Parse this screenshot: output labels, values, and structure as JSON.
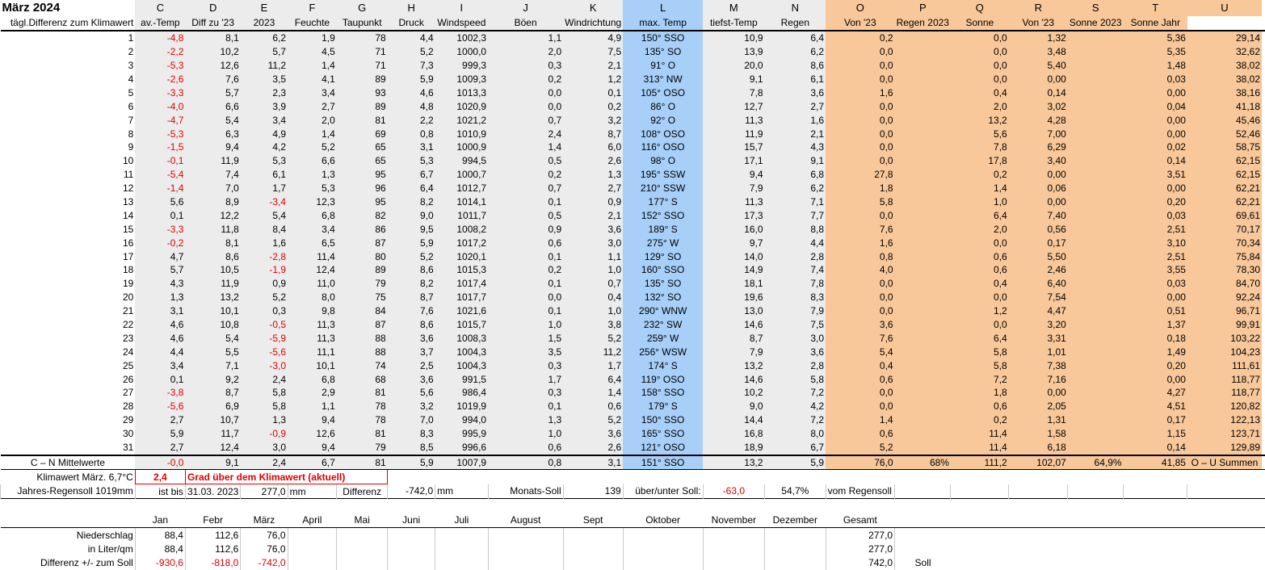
{
  "title": "März 2024",
  "col_letters": [
    "C",
    "D",
    "E",
    "F",
    "G",
    "H",
    "I",
    "J",
    "K",
    "L",
    "M",
    "N",
    "O",
    "P",
    "Q",
    "R",
    "S",
    "T",
    "U"
  ],
  "subheader": {
    "first": "tägl.Differenz zum Klimawert",
    "cols": [
      "av.-Temp",
      "Diff zu '23",
      "2023",
      "Feuchte",
      "Taupunkt",
      "Druck",
      "Windspeed",
      "Böen",
      "Windrichtung",
      "max. Temp",
      "tiefst-Temp",
      "Regen",
      "Von '23",
      "Regen 2023",
      "Sonne",
      "Von '23",
      "Sonne 2023",
      "Sonne Jahr"
    ]
  },
  "rows": [
    [
      "1",
      "-4,8",
      "8,1",
      "6,2",
      "1,9",
      "78",
      "4,4",
      "1002,3",
      "1,1",
      "4,9",
      "150° SSO",
      "10,9",
      "6,4",
      "0,2",
      "",
      "0,0",
      "1,32",
      "",
      "5,36",
      "29,14"
    ],
    [
      "2",
      "-2,2",
      "10,2",
      "5,7",
      "4,5",
      "71",
      "5,2",
      "1000,0",
      "2,0",
      "7,5",
      "135° SO",
      "13,9",
      "6,2",
      "0,0",
      "",
      "0,0",
      "3,48",
      "",
      "5,35",
      "32,62"
    ],
    [
      "3",
      "-5,3",
      "12,6",
      "11,2",
      "1,4",
      "71",
      "7,3",
      "999,3",
      "0,3",
      "2,1",
      "91° O",
      "20,0",
      "8,6",
      "0,0",
      "",
      "0,0",
      "5,40",
      "",
      "1,48",
      "38,02"
    ],
    [
      "4",
      "-2,6",
      "7,6",
      "3,5",
      "4,1",
      "89",
      "5,9",
      "1009,3",
      "0,2",
      "1,2",
      "313° NW",
      "9,1",
      "6,1",
      "0,0",
      "",
      "0,0",
      "0,00",
      "",
      "0,03",
      "38,02"
    ],
    [
      "5",
      "-3,3",
      "5,7",
      "2,3",
      "3,4",
      "93",
      "4,6",
      "1013,3",
      "0,0",
      "0,1",
      "105° OSO",
      "7,8",
      "3,6",
      "1,6",
      "",
      "0,4",
      "0,14",
      "",
      "0,00",
      "38,16"
    ],
    [
      "6",
      "-4,0",
      "6,6",
      "3,9",
      "2,7",
      "89",
      "4,8",
      "1020,9",
      "0,0",
      "0,2",
      "86° O",
      "12,7",
      "2,7",
      "0,0",
      "",
      "2,0",
      "3,02",
      "",
      "0,04",
      "41,18"
    ],
    [
      "7",
      "-4,7",
      "5,4",
      "3,4",
      "2,0",
      "81",
      "2,2",
      "1021,2",
      "0,7",
      "3,2",
      "92° O",
      "11,3",
      "1,6",
      "0,0",
      "",
      "13,2",
      "4,28",
      "",
      "0,00",
      "45,46"
    ],
    [
      "8",
      "-5,3",
      "6,3",
      "4,9",
      "1,4",
      "69",
      "0,8",
      "1010,9",
      "2,4",
      "8,7",
      "108° OSO",
      "11,9",
      "2,1",
      "0,0",
      "",
      "5,6",
      "7,00",
      "",
      "0,00",
      "52,46"
    ],
    [
      "9",
      "-1,5",
      "9,4",
      "4,2",
      "5,2",
      "65",
      "3,1",
      "1000,9",
      "1,4",
      "6,0",
      "116° OSO",
      "15,7",
      "4,3",
      "0,0",
      "",
      "7,8",
      "6,29",
      "",
      "0,02",
      "58,75"
    ],
    [
      "10",
      "-0,1",
      "11,9",
      "5,3",
      "6,6",
      "65",
      "5,3",
      "994,5",
      "0,5",
      "2,6",
      "98° O",
      "17,1",
      "9,1",
      "0,0",
      "",
      "17,8",
      "3,40",
      "",
      "0,14",
      "62,15"
    ],
    [
      "11",
      "-5,4",
      "7,4",
      "6,1",
      "1,3",
      "95",
      "6,7",
      "1000,7",
      "0,2",
      "1,3",
      "195° SSW",
      "9,4",
      "6,8",
      "27,8",
      "",
      "0,2",
      "0,00",
      "",
      "3,51",
      "62,15"
    ],
    [
      "12",
      "-1,4",
      "7,0",
      "1,7",
      "5,3",
      "96",
      "6,4",
      "1012,7",
      "0,7",
      "2,7",
      "210° SSW",
      "7,9",
      "6,2",
      "1,8",
      "",
      "1,4",
      "0,06",
      "",
      "0,00",
      "62,21"
    ],
    [
      "13",
      "5,6",
      "8,9",
      "-3,4",
      "12,3",
      "95",
      "8,2",
      "1014,1",
      "0,1",
      "0,9",
      "177° S",
      "11,3",
      "7,1",
      "5,8",
      "",
      "1,0",
      "0,00",
      "",
      "0,20",
      "62,21"
    ],
    [
      "14",
      "0,1",
      "12,2",
      "5,4",
      "6,8",
      "82",
      "9,0",
      "1011,7",
      "0,5",
      "2,1",
      "152° SSO",
      "17,3",
      "7,7",
      "0,0",
      "",
      "6,4",
      "7,40",
      "",
      "0,03",
      "69,61"
    ],
    [
      "15",
      "-3,3",
      "11,8",
      "8,4",
      "3,4",
      "86",
      "9,5",
      "1008,2",
      "0,9",
      "3,6",
      "189° S",
      "16,0",
      "8,8",
      "7,6",
      "",
      "2,0",
      "0,56",
      "",
      "2,51",
      "70,17"
    ],
    [
      "16",
      "-0,2",
      "8,1",
      "1,6",
      "6,5",
      "87",
      "5,9",
      "1017,2",
      "0,6",
      "3,0",
      "275° W",
      "9,7",
      "4,4",
      "1,6",
      "",
      "0,0",
      "0,17",
      "",
      "3,10",
      "70,34"
    ],
    [
      "17",
      "4,7",
      "8,6",
      "-2,8",
      "11,4",
      "80",
      "5,2",
      "1020,1",
      "0,1",
      "1,1",
      "129° SO",
      "14,0",
      "2,8",
      "0,8",
      "",
      "0,6",
      "5,50",
      "",
      "2,51",
      "75,84"
    ],
    [
      "18",
      "5,7",
      "10,5",
      "-1,9",
      "12,4",
      "89",
      "8,6",
      "1015,3",
      "0,2",
      "1,0",
      "160° SSO",
      "14,9",
      "7,4",
      "4,0",
      "",
      "0,6",
      "2,46",
      "",
      "3,55",
      "78,30"
    ],
    [
      "19",
      "4,3",
      "11,9",
      "0,9",
      "11,0",
      "79",
      "8,2",
      "1017,4",
      "0,1",
      "0,7",
      "135° SO",
      "18,1",
      "7,8",
      "0,0",
      "",
      "0,4",
      "6,40",
      "",
      "0,03",
      "84,70"
    ],
    [
      "20",
      "1,3",
      "13,2",
      "5,2",
      "8,0",
      "75",
      "8,7",
      "1017,7",
      "0,0",
      "0,4",
      "132° SO",
      "19,6",
      "8,3",
      "0,0",
      "",
      "0,0",
      "7,54",
      "",
      "0,00",
      "92,24"
    ],
    [
      "21",
      "3,1",
      "10,1",
      "0,3",
      "9,8",
      "84",
      "7,6",
      "1021,6",
      "0,1",
      "1,0",
      "290° WNW",
      "13,0",
      "7,9",
      "0,0",
      "",
      "1,2",
      "4,47",
      "",
      "0,51",
      "96,71"
    ],
    [
      "22",
      "4,6",
      "10,8",
      "-0,5",
      "11,3",
      "87",
      "8,6",
      "1015,7",
      "1,0",
      "3,8",
      "232° SW",
      "14,6",
      "7,5",
      "3,6",
      "",
      "0,0",
      "3,20",
      "",
      "1,37",
      "99,91"
    ],
    [
      "23",
      "4,6",
      "5,4",
      "-5,9",
      "11,3",
      "88",
      "3,6",
      "1008,3",
      "1,5",
      "5,2",
      "259° W",
      "8,7",
      "3,0",
      "7,6",
      "",
      "6,4",
      "3,31",
      "",
      "0,18",
      "103,22"
    ],
    [
      "24",
      "4,4",
      "5,5",
      "-5,6",
      "11,1",
      "88",
      "3,7",
      "1004,3",
      "3,5",
      "11,2",
      "256° WSW",
      "7,9",
      "3,6",
      "5,4",
      "",
      "5,8",
      "1,01",
      "",
      "1,49",
      "104,23"
    ],
    [
      "25",
      "3,4",
      "7,1",
      "-3,0",
      "10,1",
      "74",
      "2,5",
      "1004,3",
      "0,3",
      "1,7",
      "174° S",
      "13,2",
      "2,8",
      "0,4",
      "",
      "5,8",
      "7,38",
      "",
      "0,20",
      "111,61"
    ],
    [
      "26",
      "0,1",
      "9,2",
      "2,4",
      "6,8",
      "68",
      "3,6",
      "991,5",
      "1,7",
      "6,4",
      "119° OSO",
      "14,6",
      "5,8",
      "0,6",
      "",
      "7,2",
      "7,16",
      "",
      "0,00",
      "118,77"
    ],
    [
      "27",
      "-3,8",
      "8,7",
      "5,8",
      "2,9",
      "81",
      "5,6",
      "986,4",
      "0,3",
      "1,4",
      "158° SSO",
      "10,2",
      "7,2",
      "0,0",
      "",
      "1,8",
      "0,00",
      "",
      "4,27",
      "118,77"
    ],
    [
      "28",
      "-5,6",
      "6,9",
      "5,8",
      "1,1",
      "78",
      "3,2",
      "1019,9",
      "0,1",
      "0,6",
      "179° S",
      "9,0",
      "4,2",
      "0,0",
      "",
      "0,6",
      "2,05",
      "",
      "4,51",
      "120,82"
    ],
    [
      "29",
      "2,7",
      "10,7",
      "1,3",
      "9,4",
      "78",
      "7,0",
      "994,0",
      "1,3",
      "5,2",
      "150° SSO",
      "14,4",
      "7,2",
      "1,4",
      "",
      "0,2",
      "1,31",
      "",
      "0,17",
      "122,13"
    ],
    [
      "30",
      "5,9",
      "11,7",
      "-0,9",
      "12,6",
      "81",
      "8,3",
      "995,9",
      "1,0",
      "3,6",
      "165° SSO",
      "16,8",
      "8,0",
      "0,6",
      "",
      "11,4",
      "1,58",
      "",
      "1,15",
      "123,71"
    ],
    [
      "31",
      "2,7",
      "12,4",
      "3,0",
      "9,4",
      "79",
      "8,5",
      "996,6",
      "0,6",
      "2,6",
      "121° OSO",
      "18,9",
      "6,7",
      "5,2",
      "",
      "11,4",
      "6,18",
      "",
      "0,14",
      "129,89"
    ]
  ],
  "mean_row": [
    "C – N Mittelwerte",
    "-0,0",
    "9,1",
    "2,4",
    "6,7",
    "81",
    "5,9",
    "1007,9",
    "0,8",
    "3,1",
    "151° SSO",
    "13,2",
    "5,9",
    "76,0",
    "68%",
    "111,2",
    "102,07",
    "64,9%",
    "41,85",
    "O – U Summen"
  ],
  "klimawert": {
    "label": "Klimawert März. 6,7°C",
    "value": "2,4",
    "text": "Grad über dem Klimawert (aktuell)"
  },
  "regensoll": {
    "label": "Jahres-Regensoll 1019mm",
    "ist_bis": "ist bis",
    "date": "31.03. 2023",
    "amount": "277,0",
    "unit": "mm",
    "diff_label": "Differenz",
    "diff_value": "-742,0",
    "diff_unit": "mm",
    "monats_label": "Monats-Soll",
    "monats_value": "139",
    "ueber_label": "über/unter Soll:",
    "ueber_value": "-63,0",
    "percent": "54,7%",
    "vom": "vom Regensoll"
  },
  "months": [
    "Jan",
    "Febr",
    "März",
    "April",
    "Mai",
    "Juni",
    "Juli",
    "August",
    "Sept",
    "Oktober",
    "November",
    "Dezember",
    "Gesamt"
  ],
  "niederschlag": {
    "label": "Niederschlag",
    "values": [
      "88,4",
      "112,6",
      "76,0"
    ],
    "total": "277,0"
  },
  "liter": {
    "label": "in Liter/qm",
    "values": [
      "88,4",
      "112,6",
      "76,0"
    ],
    "total": "277,0"
  },
  "differenz": {
    "label": "Differenz  +/- zum Soll",
    "values": [
      "-930,6",
      "-818,0",
      "-742,0"
    ],
    "total": "742,0",
    "soll": "Soll"
  }
}
